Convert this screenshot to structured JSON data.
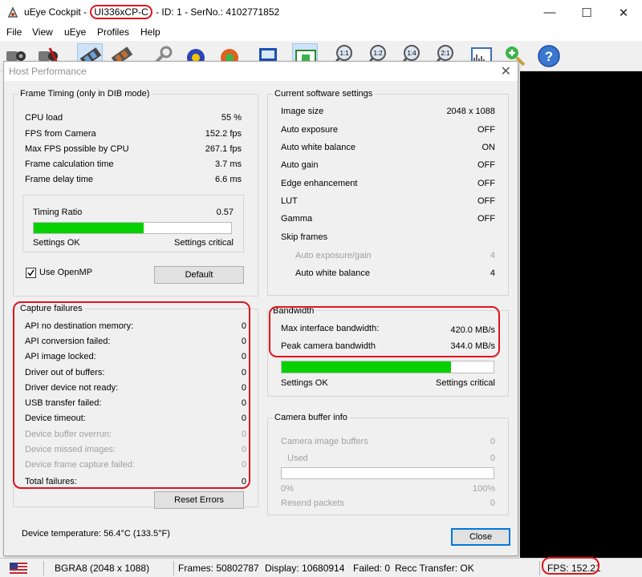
{
  "window": {
    "app_name": "uEye Cockpit -",
    "model": "UI336xCP-C",
    "rest": "- ID: 1 - SerNo.: 4102771852",
    "controls": {
      "minimize": "—",
      "maximize": "☐",
      "close": "✕"
    }
  },
  "menu": [
    "File",
    "View",
    "uEye",
    "Profiles",
    "Help"
  ],
  "toolbar": {
    "zoom_labels": [
      "1:1",
      "1:2",
      "1:4",
      "2:1"
    ],
    "help_symbol": "?"
  },
  "dialog": {
    "title": "Host Performance",
    "close_symbol": "✕",
    "frame_timing": {
      "title": "Frame Timing (only in DIB mode)",
      "rows": [
        {
          "label": "CPU load",
          "value": "55 %"
        },
        {
          "label": "FPS from Camera",
          "value": "152.2 fps"
        },
        {
          "label": "Max FPS possible by CPU",
          "value": "267.1 fps"
        },
        {
          "label": "Frame calculation time",
          "value": "3.7 ms"
        },
        {
          "label": "Frame delay time",
          "value": "6.6 ms"
        }
      ],
      "timing_ratio_label": "Timing Ratio",
      "timing_ratio_value": "0.57",
      "timing_ratio_fraction": 0.555,
      "settings_ok": "Settings OK",
      "settings_critical": "Settings critical",
      "use_openmp_label": "Use OpenMP",
      "use_openmp_checked": true,
      "default_button": "Default"
    },
    "capture_failures": {
      "title": "Capture failures",
      "rows": [
        {
          "label": "API no destination memory:",
          "value": "0",
          "disabled": false
        },
        {
          "label": "API conversion failed:",
          "value": "0",
          "disabled": false
        },
        {
          "label": "API image locked:",
          "value": "0",
          "disabled": false
        },
        {
          "label": "Driver out of buffers:",
          "value": "0",
          "disabled": false
        },
        {
          "label": "Driver device not ready:",
          "value": "0",
          "disabled": false
        },
        {
          "label": "USB transfer failed:",
          "value": "0",
          "disabled": false
        },
        {
          "label": "Device timeout:",
          "value": "0",
          "disabled": false
        },
        {
          "label": "Device buffer overrun:",
          "value": "0",
          "disabled": true
        },
        {
          "label": "Device missed images:",
          "value": "0",
          "disabled": true
        },
        {
          "label": "Device frame capture failed:",
          "value": "0",
          "disabled": true
        },
        {
          "label": "Total failures:",
          "value": "0",
          "disabled": false
        }
      ],
      "reset_button": "Reset Errors"
    },
    "device_temperature": "Device temperature:  56.4°C  (133.5°F)",
    "software_settings": {
      "title": "Current software settings",
      "rows": [
        {
          "label": "Image size",
          "value": "2048 x 1088",
          "disabled": false
        },
        {
          "label": "Auto exposure",
          "value": "OFF",
          "disabled": false
        },
        {
          "label": "Auto white balance",
          "value": "ON",
          "disabled": false
        },
        {
          "label": "Auto gain",
          "value": "OFF",
          "disabled": false
        },
        {
          "label": "Edge enhancement",
          "value": "OFF",
          "disabled": false
        },
        {
          "label": "LUT",
          "value": "OFF",
          "disabled": false
        },
        {
          "label": "Gamma",
          "value": "OFF",
          "disabled": false
        },
        {
          "label": "Skip frames",
          "value": "",
          "disabled": false
        }
      ],
      "skip_rows": [
        {
          "label": "Auto exposure/gain",
          "value": "4",
          "disabled": true
        },
        {
          "label": "Auto white balance",
          "value": "4",
          "disabled": false
        }
      ]
    },
    "bandwidth": {
      "title": "Bandwidth",
      "rows": [
        {
          "label": "Max interface bandwidth:",
          "value": "420.0 MB/s"
        },
        {
          "label": "Peak camera bandwidth",
          "value": "344.0 MB/s"
        }
      ],
      "fraction": 0.8,
      "settings_ok": "Settings OK",
      "settings_critical": "Settings critical"
    },
    "camera_buffer": {
      "title": "Camera buffer info",
      "rows": [
        {
          "label": "Camera image buffers",
          "value": "0"
        },
        {
          "label": "Used",
          "value": "0"
        }
      ],
      "fraction": 0,
      "min_label": "0%",
      "max_label": "100%",
      "resend_label": "Resend packets",
      "resend_value": "0"
    },
    "close_button": "Close"
  },
  "statusbar": {
    "format": "BGRA8 (2048 x 1088)",
    "frames": "Frames: 50802787",
    "display": "Display: 10680914",
    "failed": "Failed: 0",
    "recc": "Recc Transfer: OK",
    "fps": "FPS: 152.21"
  },
  "colors": {
    "highlight_red": "#e0141e",
    "bar_green": "#06d000",
    "disabled_text": "#a0a0a0"
  }
}
